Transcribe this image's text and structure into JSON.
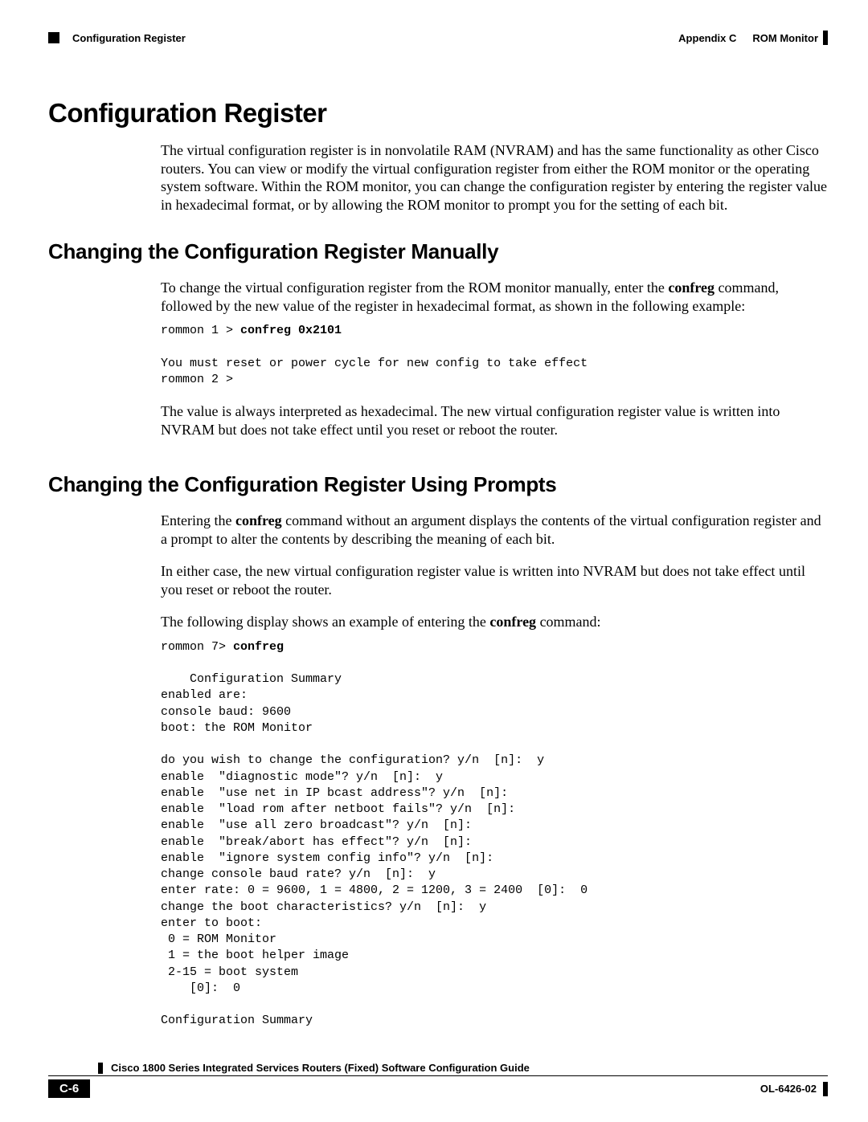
{
  "header": {
    "section_name": "Configuration Register",
    "appendix_label": "Appendix C",
    "appendix_title": "ROM Monitor"
  },
  "h1": "Configuration Register",
  "intro_p1": "The virtual configuration register is in nonvolatile RAM (NVRAM) and has the same functionality as other Cisco routers. You can view or modify the virtual configuration register from either the ROM monitor or the operating system software. Within the ROM monitor, you can change the configuration register by entering the register value in hexadecimal format, or by allowing the ROM monitor to prompt you for the setting of each bit.",
  "h2a": "Changing the Configuration Register Manually",
  "manual_p1_a": "To change the virtual configuration register from the ROM monitor manually, enter the ",
  "manual_p1_bold": "confreg",
  "manual_p1_b": " command, followed by the new value of the register in hexadecimal format, as shown in the following example:",
  "code1_prefix": "rommon 1 > ",
  "code1_bold": "confreg 0x2101",
  "code1_rest": "\n\nYou must reset or power cycle for new config to take effect\nrommon 2 >",
  "manual_p2": "The value is always interpreted as hexadecimal. The new virtual configuration register value is written into NVRAM but does not take effect until you reset or reboot the router.",
  "h2b": "Changing the Configuration Register Using Prompts",
  "prompts_p1_a": "Entering the ",
  "prompts_p1_bold": "confreg",
  "prompts_p1_b": " command without an argument displays the contents of the virtual configuration register and a prompt to alter the contents by describing the meaning of each bit.",
  "prompts_p2": "In either case, the new virtual configuration register value is written into NVRAM but does not take effect until you reset or reboot the router.",
  "prompts_p3_a": "The following display shows an example of entering the ",
  "prompts_p3_bold": "confreg",
  "prompts_p3_b": " command:",
  "code2_prefix": "rommon 7> ",
  "code2_bold": "confreg",
  "code2_rest": "\n\n    Configuration Summary\nenabled are:\nconsole baud: 9600\nboot: the ROM Monitor\n\ndo you wish to change the configuration? y/n  [n]:  y\nenable  \"diagnostic mode\"? y/n  [n]:  y\nenable  \"use net in IP bcast address\"? y/n  [n]:\nenable  \"load rom after netboot fails\"? y/n  [n]:  \nenable  \"use all zero broadcast\"? y/n  [n]:  \nenable  \"break/abort has effect\"? y/n  [n]:  \nenable  \"ignore system config info\"? y/n  [n]:  \nchange console baud rate? y/n  [n]:  y\nenter rate: 0 = 9600, 1 = 4800, 2 = 1200, 3 = 2400  [0]:  0\nchange the boot characteristics? y/n  [n]:  y\nenter to boot:\n 0 = ROM Monitor\n 1 = the boot helper image\n 2-15 = boot system\n    [0]:  0\n\nConfiguration Summary",
  "footer": {
    "doc_title": "Cisco 1800 Series Integrated Services Routers (Fixed) Software Configuration Guide",
    "page_number": "C-6",
    "doc_number": "OL-6426-02"
  }
}
